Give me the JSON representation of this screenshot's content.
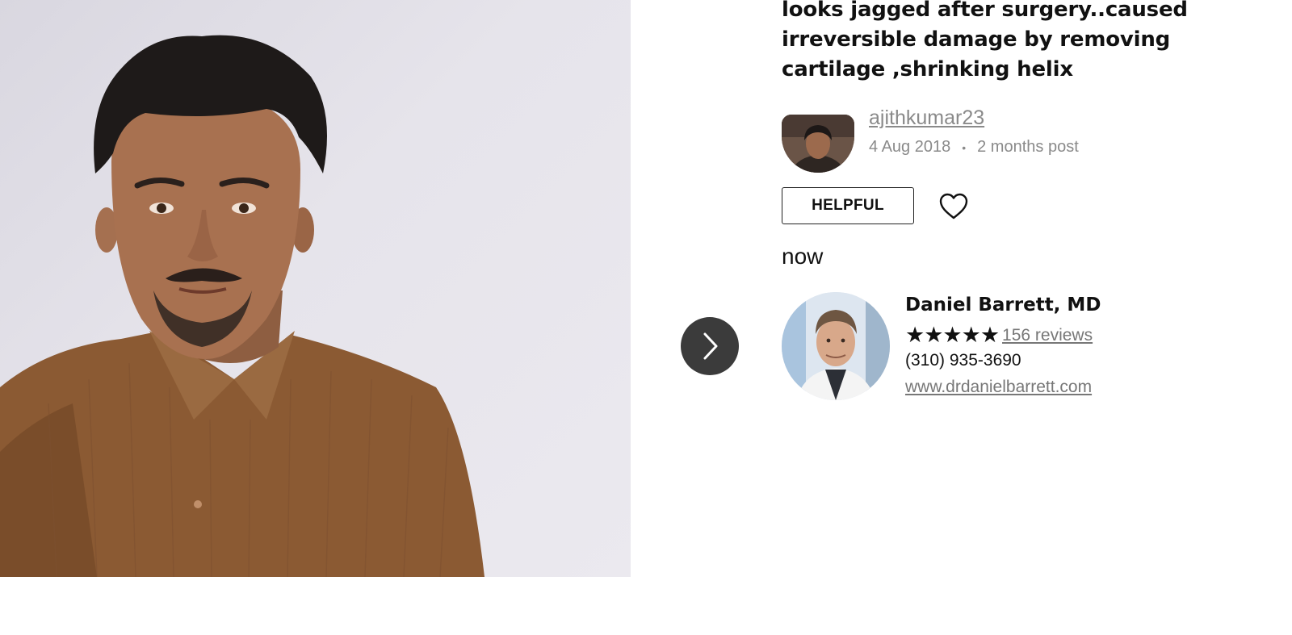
{
  "post": {
    "title_lines": [
      "looks jagged after surgery..caused",
      "irreversible damage by removing",
      "cartilage ,shrinking helix"
    ],
    "author": {
      "username": "ajithkumar23",
      "date": "4 Aug 2018",
      "separator": "•",
      "relative": "2 months post"
    },
    "helpful_label": "HELPFUL",
    "status_text": "now"
  },
  "doctor": {
    "name": "Daniel Barrett, MD",
    "stars": "★★★★★",
    "rating": 5,
    "reviews_label": "156 reviews",
    "phone": "(310) 935-3690",
    "website": "www.drdanielbarrett.com"
  },
  "icons": {
    "next": "chevron-right-icon",
    "favorite": "heart-outline-icon"
  },
  "colors": {
    "text": "#111111",
    "muted": "#8a8a8a",
    "link": "#777777",
    "next_button_bg": "#3b3b3b",
    "background": "#ffffff"
  }
}
